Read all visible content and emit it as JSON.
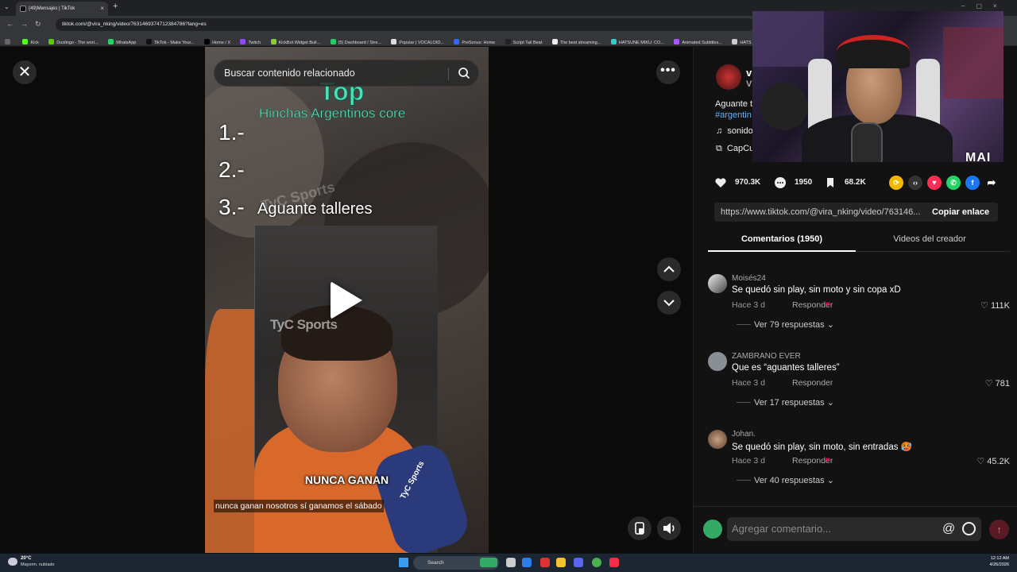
{
  "browser": {
    "tab_title": "(49)Mensajes | TikTok",
    "url": "tiktok.com/@vira_nking/video/7631469374712384786?lang=es",
    "bookmarks": [
      "Kick",
      "Duolingo - The worl...",
      "WhatsApp",
      "TikTok - Make Your...",
      "Home / X",
      "Twitch",
      "KickBot Widget Buil...",
      "(5) Dashboard / Stre...",
      "Popular | VOCALOID...",
      "PreSonus: Home",
      "Script Tail Beat",
      "The best streaming...",
      "HATSUNE MIKU: CO...",
      "Animated Subtitles...",
      "HATS"
    ]
  },
  "video": {
    "search_placeholder": "Buscar contenido relacionado",
    "overlay_title": "Top",
    "overlay_subtitle": "Hinchas Argentinos core",
    "rank1": "1.-",
    "rank2": "2.-",
    "rank3": "3.-",
    "rank3_text": "Aguante talleres",
    "watermark": "TyC Sports",
    "mic_label": "TyC Sports",
    "caption_big": "NUNCA GANAN",
    "caption_small": "nunca ganan nosotros sí ganamos el sábado"
  },
  "post": {
    "author": "vi",
    "author_sub": "VI",
    "description": "Aguante t",
    "hashtag": "#argentin •",
    "music": "sonido",
    "effect": "CapCu",
    "likes": "970.3K",
    "comments": "1950",
    "saves": "68.2K",
    "link": "https://www.tiktok.com/@vira_nking/video/763146...",
    "copy_label": "Copiar enlace"
  },
  "tabs": {
    "comments": "Comentarios (1950)",
    "videos": "Videos del creador"
  },
  "comments": [
    {
      "user": "Moisés24",
      "text": "Se quedó sin play, sin moto y sin copa xD",
      "time": "Hace 3 d",
      "reply": "Responder",
      "likes": "111K",
      "view": "Ver 79 respuestas",
      "creator_liked": true
    },
    {
      "user": "ZAMBRANO EVER",
      "text": "Que es “aguantes talleres”",
      "time": "Hace 3 d",
      "reply": "Responder",
      "likes": "781",
      "view": "Ver 17 respuestas",
      "creator_liked": false
    },
    {
      "user": "Johan.",
      "text": "Se quedó sin play, sin moto, sin entradas 🥵",
      "time": "Hace 3 d",
      "reply": "Responder",
      "likes": "45.2K",
      "view": "Ver 40 respuestas",
      "creator_liked": true
    }
  ],
  "comment_input": {
    "placeholder": "Agregar comentario...",
    "at": "@"
  },
  "webcam": {
    "label": "MAI"
  },
  "taskbar": {
    "temp": "20°C",
    "weather": "Mayorm. nublado",
    "search": "Search",
    "time": "12:12 AM",
    "date": "4/26/2026"
  },
  "colors": {
    "accent": "#fe2c55",
    "overlay_text": "#4be0b6",
    "link_blue": "#5fb3ff"
  }
}
